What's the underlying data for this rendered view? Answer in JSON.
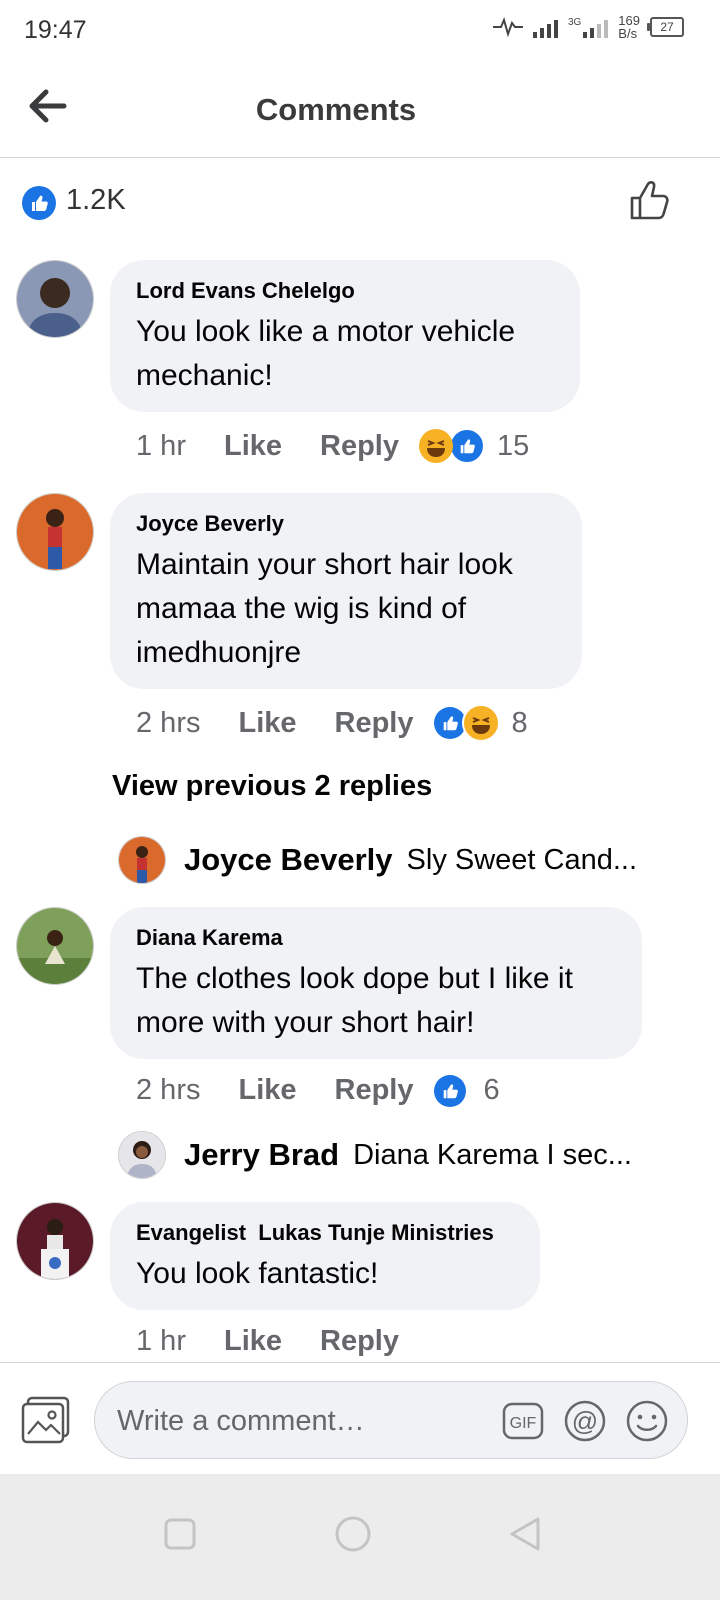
{
  "status_bar": {
    "time": "19:47",
    "network": "3G",
    "speed_value": "169",
    "speed_unit": "B/s",
    "battery": "27"
  },
  "header": {
    "title": "Comments",
    "back_icon": "arrow-left-icon"
  },
  "reactions_summary": {
    "count": "1.2K"
  },
  "comments": [
    {
      "author": "Lord Evans Chelelgo",
      "text": "You look like a motor vehicle mechanic!",
      "time": "1 hr",
      "like_label": "Like",
      "reply_label": "Reply",
      "reaction_count": "15"
    },
    {
      "author": "Joyce Beverly",
      "text": "Maintain your short hair look mamaa the wig is kind of imedhuonjre",
      "time": "2 hrs",
      "like_label": "Like",
      "reply_label": "Reply",
      "reaction_count": "8"
    },
    {
      "author": "Diana Karema",
      "text": "The clothes look dope but I like it more with your short hair!",
      "time": "2 hrs",
      "like_label": "Like",
      "reply_label": "Reply",
      "reaction_count": "6"
    },
    {
      "author": "Evangelist  Lukas Tunje Ministries",
      "text": "You look fantastic!",
      "time": "1 hr",
      "like_label": "Like",
      "reply_label": "Reply"
    }
  ],
  "view_previous": "View previous 2 replies",
  "replies": [
    {
      "name": "Joyce Beverly",
      "text": "Sly Sweet Cand..."
    },
    {
      "name": "Jerry Brad",
      "text": "Diana Karema I sec..."
    }
  ],
  "composer": {
    "placeholder": "Write a comment…",
    "gif_label": "GIF",
    "at_label": "@"
  },
  "colors": {
    "brand_blue": "#1b74e4",
    "bubble_bg": "#f0f2f5",
    "meta_grey": "#65676b",
    "haha_yellow": "#f7b125"
  }
}
